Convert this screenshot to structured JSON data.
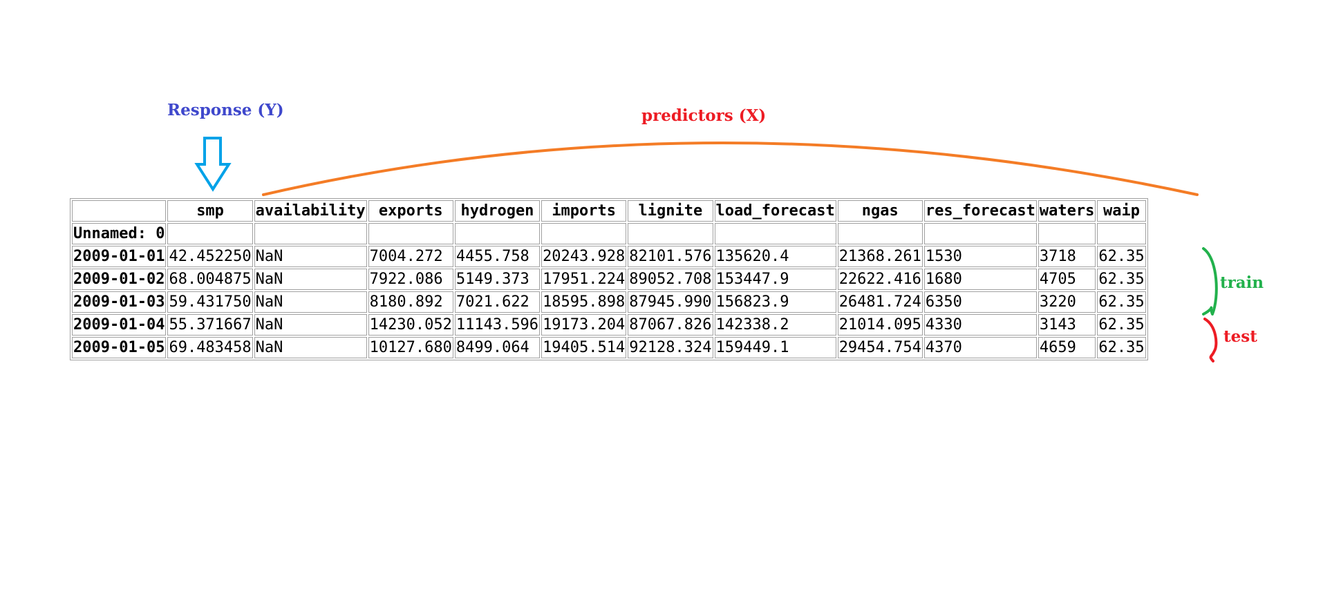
{
  "annotations": {
    "response_label": "Response (Y)",
    "predictors_label": "predictors (X)",
    "train_label": "train",
    "test_label": "test"
  },
  "colors": {
    "response": "#3f48cc",
    "response_arrow": "#00a2e8",
    "predictors": "#ed1c24",
    "predictors_arc": "#f47c26",
    "train": "#22b14c",
    "test": "#ed1c24"
  },
  "icons": {
    "response_arrow": "down-arrow-icon",
    "train_bracket": "curly-brace-icon",
    "test_bracket": "curly-brace-icon"
  },
  "table": {
    "columns": [
      "",
      "smp",
      "availability",
      "exports",
      "hydrogen",
      "imports",
      "lignite",
      "load_forecast",
      "ngas",
      "res_forecast",
      "waters",
      "waip"
    ],
    "index_name": "Unnamed: 0",
    "rows": [
      {
        "index": "2009-01-01",
        "cells": [
          "42.452250",
          "NaN",
          "7004.272",
          "4455.758",
          "20243.928",
          "82101.576",
          "135620.4",
          "21368.261",
          "1530",
          "3718",
          "62.35"
        ]
      },
      {
        "index": "2009-01-02",
        "cells": [
          "68.004875",
          "NaN",
          "7922.086",
          "5149.373",
          "17951.224",
          "89052.708",
          "153447.9",
          "22622.416",
          "1680",
          "4705",
          "62.35"
        ]
      },
      {
        "index": "2009-01-03",
        "cells": [
          "59.431750",
          "NaN",
          "8180.892",
          "7021.622",
          "18595.898",
          "87945.990",
          "156823.9",
          "26481.724",
          "6350",
          "3220",
          "62.35"
        ]
      },
      {
        "index": "2009-01-04",
        "cells": [
          "55.371667",
          "NaN",
          "14230.052",
          "11143.596",
          "19173.204",
          "87067.826",
          "142338.2",
          "21014.095",
          "4330",
          "3143",
          "62.35"
        ]
      },
      {
        "index": "2009-01-05",
        "cells": [
          "69.483458",
          "NaN",
          "10127.680",
          "8499.064",
          "19405.514",
          "92128.324",
          "159449.1",
          "29454.754",
          "4370",
          "4659",
          "62.35"
        ]
      }
    ]
  }
}
